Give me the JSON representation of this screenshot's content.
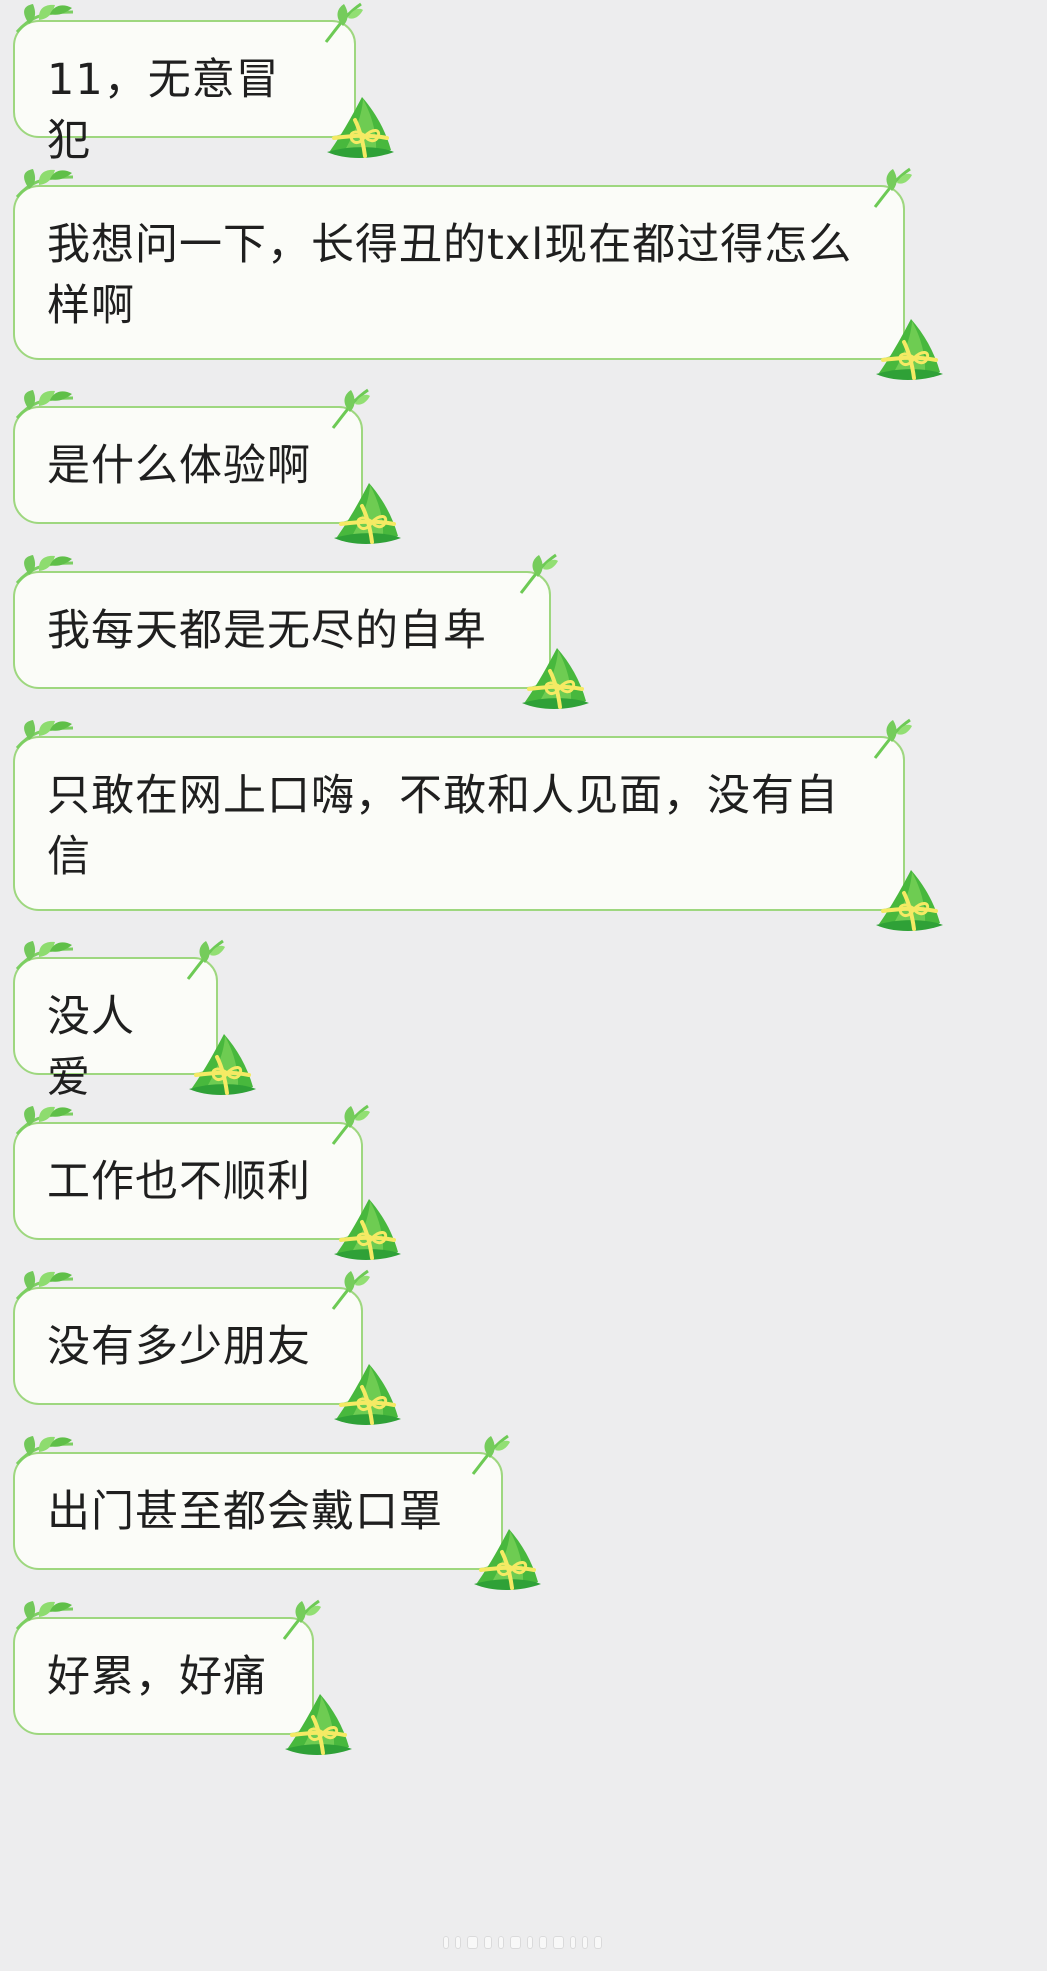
{
  "conversation": {
    "messages": [
      {
        "text": "11，无意冒犯"
      },
      {
        "text": "我想问一下，长得丑的txl现在都过得怎么样啊"
      },
      {
        "text": "是什么体验啊"
      },
      {
        "text": "我每天都是无尽的自卑"
      },
      {
        "text": "只敢在网上口嗨，不敢和人见面，没有自信"
      },
      {
        "text": "没人爱"
      },
      {
        "text": "工作也不顺利"
      },
      {
        "text": "没有多少朋友"
      },
      {
        "text": "出门甚至都会戴口罩"
      },
      {
        "text": "好累，好痛"
      }
    ]
  },
  "colors": {
    "background": "#ededee",
    "bubble_fill": "#fbfcf8",
    "bubble_border": "#9ed77f",
    "zongzi_green": "#48b83d",
    "zongzi_tie": "#f5ea64"
  },
  "icons": {
    "bubble_decoration": "zongzi-icon",
    "leaf_decoration": "bamboo-leaf-icon"
  }
}
